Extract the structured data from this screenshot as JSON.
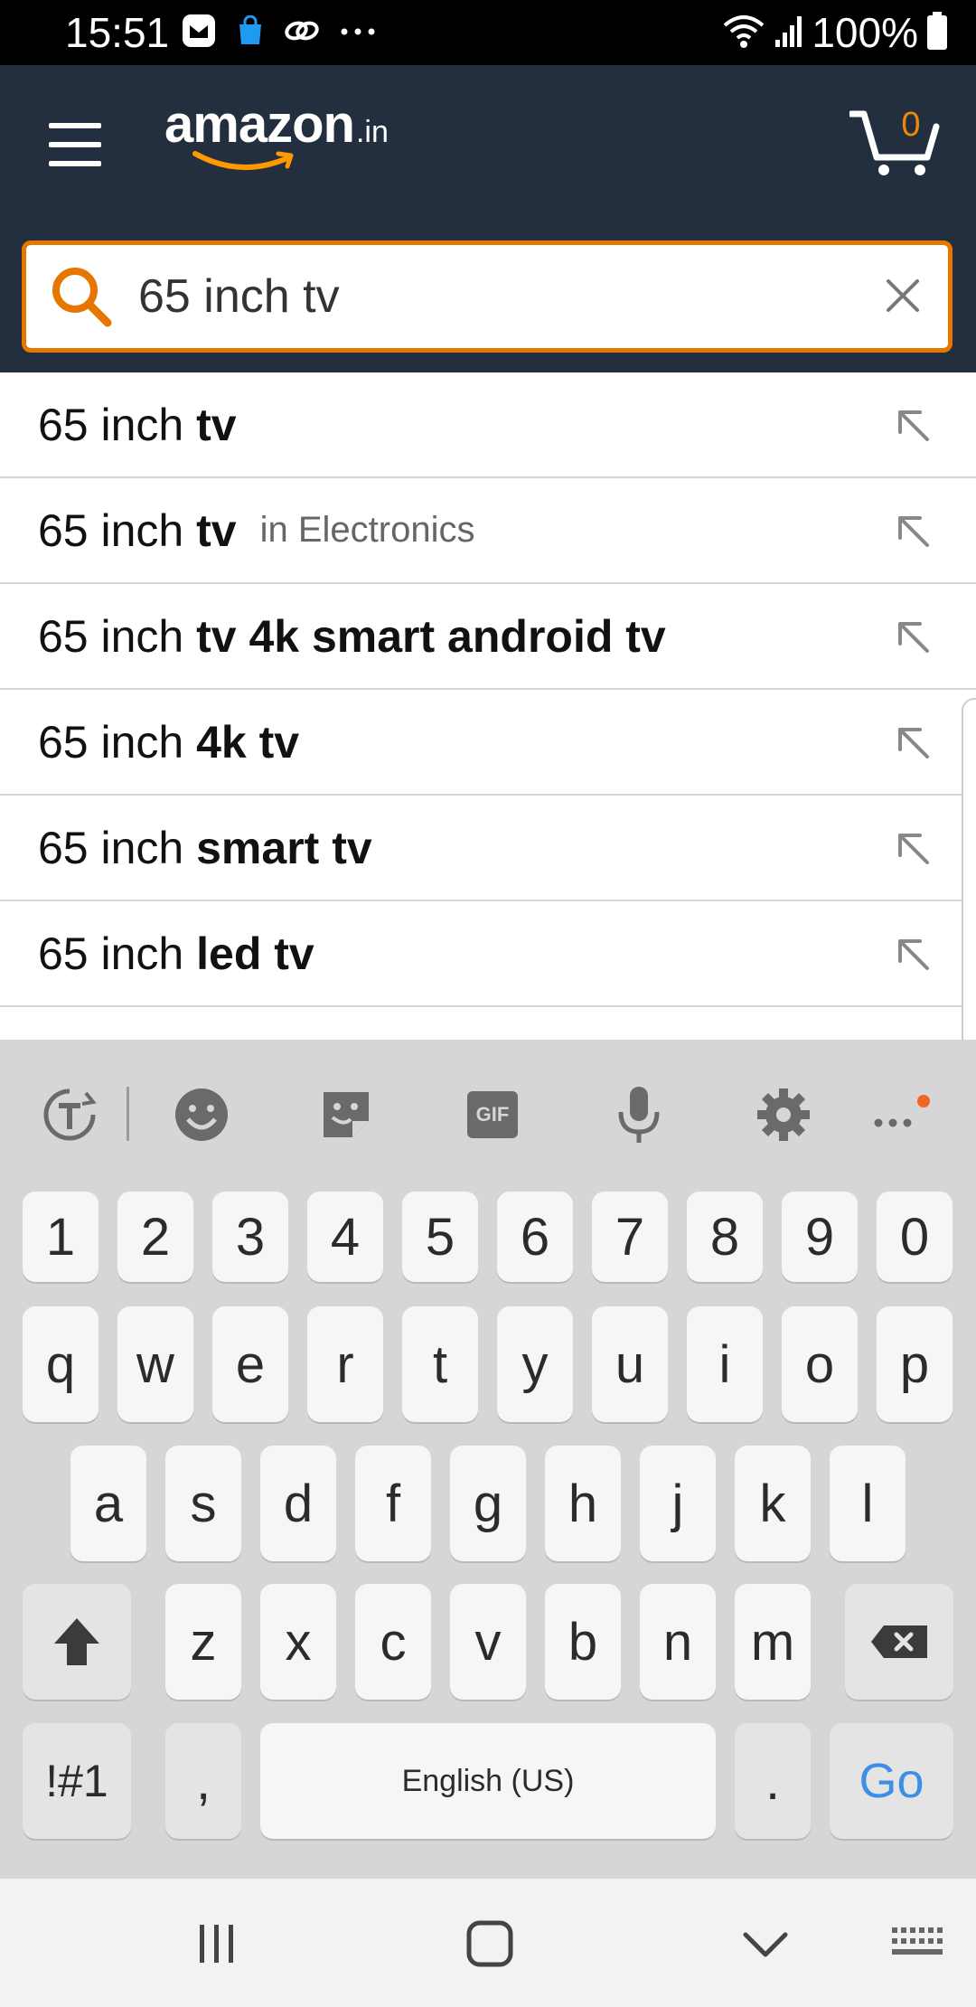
{
  "status_bar": {
    "time": "15:51",
    "battery": "100%",
    "icons": [
      "app-notification-icon",
      "shopping-bag-icon",
      "link-icon",
      "more-notifications-icon",
      "wifi-icon",
      "signal-icon",
      "battery-icon"
    ]
  },
  "header": {
    "logo_text": "amazon",
    "logo_tld": ".in",
    "cart_count": "0",
    "brand_color": "#232f3e",
    "accent_color": "#e77600"
  },
  "search": {
    "value": "65 inch tv",
    "placeholder": ""
  },
  "suggestions": [
    {
      "prefix": "65 inch ",
      "bold": "tv",
      "department": ""
    },
    {
      "prefix": "65 inch ",
      "bold": "tv",
      "department": "in Electronics"
    },
    {
      "prefix": "65 inch ",
      "bold": "tv 4k smart android tv",
      "department": ""
    },
    {
      "prefix": "65 inch ",
      "bold": "4k tv",
      "department": ""
    },
    {
      "prefix": "65 inch ",
      "bold": "smart tv",
      "department": ""
    },
    {
      "prefix": "65 inch ",
      "bold": "led tv",
      "department": ""
    }
  ],
  "keyboard": {
    "toolbar": [
      "translate-icon",
      "emoji-icon",
      "sticker-icon",
      "gif-icon",
      "microphone-icon",
      "settings-icon",
      "more-icon"
    ],
    "gif_label": "GIF",
    "row_numbers": [
      "1",
      "2",
      "3",
      "4",
      "5",
      "6",
      "7",
      "8",
      "9",
      "0"
    ],
    "row_top": [
      "q",
      "w",
      "e",
      "r",
      "t",
      "y",
      "u",
      "i",
      "o",
      "p"
    ],
    "row_middle": [
      "a",
      "s",
      "d",
      "f",
      "g",
      "h",
      "j",
      "k",
      "l"
    ],
    "row_bottom": [
      "z",
      "x",
      "c",
      "v",
      "b",
      "n",
      "m"
    ],
    "symbols_label": "!#1",
    "comma_label": ",",
    "space_label": "English (US)",
    "period_label": ".",
    "go_label": "Go",
    "go_color": "#3d8fe6"
  },
  "nav_bar": {
    "buttons": [
      "recent-apps-icon",
      "home-icon",
      "back-icon",
      "keyboard-switch-icon"
    ]
  }
}
